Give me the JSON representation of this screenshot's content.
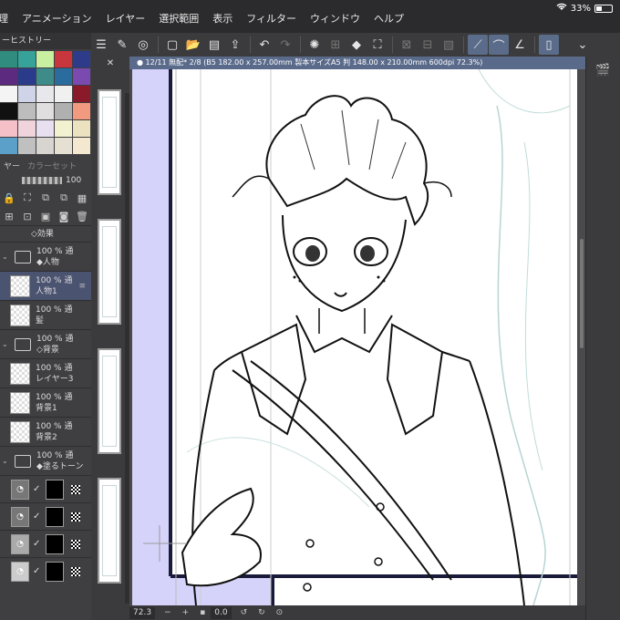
{
  "menubar": {
    "items": [
      "理",
      "アニメーション",
      "レイヤー",
      "選択範囲",
      "表示",
      "フィルター",
      "ウィンドウ",
      "ヘルプ"
    ],
    "battery": "33%"
  },
  "toolbar": {
    "icons": [
      "menu-icon",
      "edit-icon",
      "target-icon",
      "new-file-icon",
      "open-folder-icon",
      "save-icon",
      "export-icon",
      "undo-icon",
      "redo-icon",
      "gear-spin-icon",
      "transform-icon",
      "fill-icon",
      "crop-icon",
      "clear-icon",
      "dim1-icon",
      "dim2-icon",
      "ruler-snap-icon",
      "curve-snap-icon",
      "angle-snap-icon",
      "tablet-icon",
      "chevron-down-icon"
    ]
  },
  "left_panel": {
    "history_title": "ーヒストリー",
    "swatch_colors": [
      "#2f8c7e",
      "#37a29a",
      "#c8f0a0",
      "#c9363e",
      "#2d3b8a",
      "#5c2a7e",
      "#2b3b8c",
      "#3e8c8a",
      "#2a6c9e",
      "#7a4ab0",
      "#f4f4f4",
      "#cfd4e8",
      "#e8e8ec",
      "#f0f0f0",
      "#8a1a2a",
      "#111111",
      "#bdbdbd",
      "#e0dede",
      "#b0b0b0",
      "#f29a80",
      "#f6c0c8",
      "#f0d4dc",
      "#e8e0f0",
      "#f2f2d0",
      "#ece2c0",
      "#5aa0c8",
      "#c0c0c0",
      "#d8d4d0",
      "#e6e0d2",
      "#f4e8d0"
    ],
    "tabs": [
      "ヤー",
      "カラーセット"
    ],
    "opacity_value": "100",
    "layers": [
      {
        "kind": "text",
        "line1": "◇効果"
      },
      {
        "kind": "folder",
        "line1": "100 % 通",
        "line2": "◆人物"
      },
      {
        "kind": "raster",
        "line1": "100 % 通",
        "line2": "人物1",
        "selected": true
      },
      {
        "kind": "raster",
        "line1": "100 % 通",
        "line2": "髪"
      },
      {
        "kind": "folder",
        "line1": "100 % 通",
        "line2": "◇背景"
      },
      {
        "kind": "raster",
        "line1": "100 % 通",
        "line2": "レイヤー3"
      },
      {
        "kind": "raster",
        "line1": "100 % 通",
        "line2": "背景1"
      },
      {
        "kind": "raster",
        "line1": "100 % 通",
        "line2": "背景2"
      },
      {
        "kind": "folder",
        "line1": "100 % 通",
        "line2": "◆塗るトーン"
      }
    ]
  },
  "document": {
    "tab_title": "12/11 無配* 2/8 (B5 182.00 x 257.00mm 製本サイズA5 判 148.00 x 210.00mm 600dpi 72.3%)"
  },
  "statusbar": {
    "zoom": "72.3",
    "angle": "0.0"
  }
}
